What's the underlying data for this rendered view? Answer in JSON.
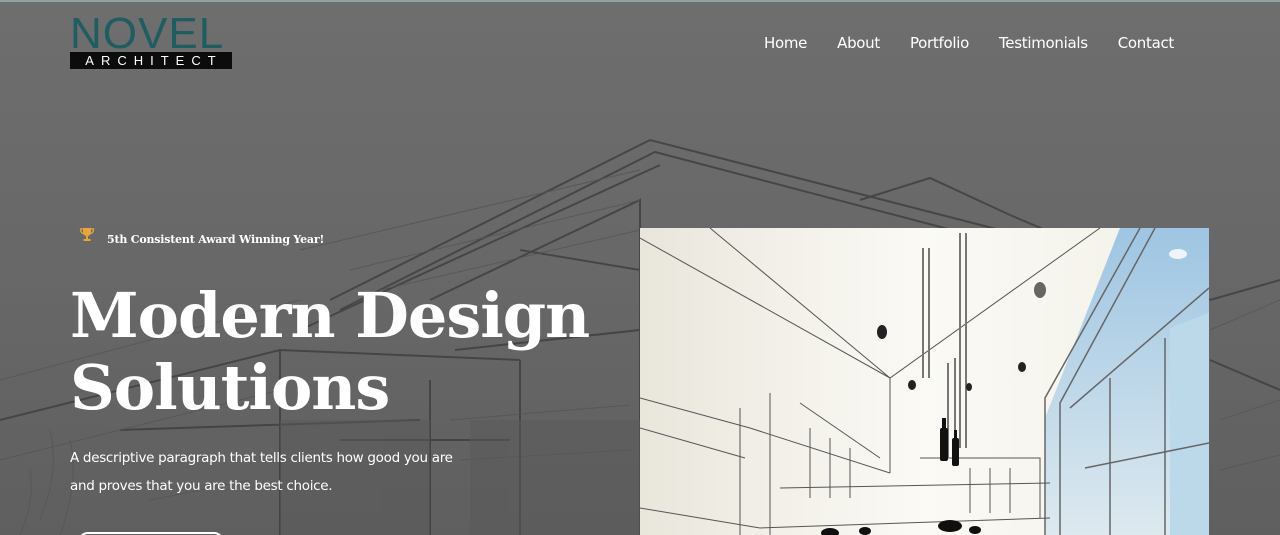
{
  "brand": {
    "name": "NOVEL",
    "tagline": "ARCHITECT"
  },
  "nav": {
    "items": [
      "Home",
      "About",
      "Portfolio",
      "Testimonials",
      "Contact"
    ]
  },
  "hero": {
    "badge_icon": "trophy-icon",
    "badge_text": "5th Consistent Award Winning Year!",
    "headline_line1": "Modern Design",
    "headline_line2": "Solutions",
    "description_line1": "A descriptive paragraph that tells clients how good you are",
    "description_line2": "and proves that you are the best choice."
  },
  "colors": {
    "overlay": "#6d6d6d",
    "brand_teal": "#1f5d61",
    "text": "#ffffff",
    "trophy": "#e8a53a"
  }
}
